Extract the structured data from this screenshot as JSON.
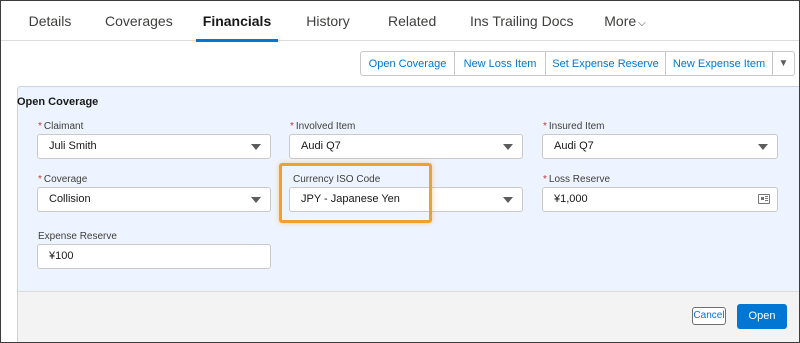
{
  "tabs": [
    {
      "label": "Details"
    },
    {
      "label": "Coverages"
    },
    {
      "label": "Financials"
    },
    {
      "label": "History"
    },
    {
      "label": "Related"
    },
    {
      "label": "Ins Trailing Docs"
    },
    {
      "label": "More"
    }
  ],
  "active_tab": "Financials",
  "actions": {
    "open_coverage": "Open Coverage",
    "new_loss_item": "New Loss Item",
    "set_expense_reserve": "Set Expense Reserve",
    "new_expense_item": "New Expense Item"
  },
  "form": {
    "title": "Open Coverage",
    "claimant": {
      "label": "Claimant",
      "value": "Juli Smith"
    },
    "involved_item": {
      "label": "Involved Item",
      "value": "Audi Q7"
    },
    "insured_item": {
      "label": "Insured Item",
      "value": "Audi Q7"
    },
    "coverage": {
      "label": "Coverage",
      "value": "Collision"
    },
    "currency": {
      "label": "Currency ISO Code",
      "value": "JPY - Japanese Yen"
    },
    "loss_reserve": {
      "label": "Loss Reserve",
      "value": "¥1,000"
    },
    "expense_reserve": {
      "label": "Expense Reserve",
      "value": "¥100"
    },
    "required_marker": "*"
  },
  "footer": {
    "cancel_label": "Cancel",
    "open_label": "Open"
  },
  "colors": {
    "brand": "#0176d3",
    "highlight": "#f0a030",
    "panel_bg": "#eef4ff"
  }
}
